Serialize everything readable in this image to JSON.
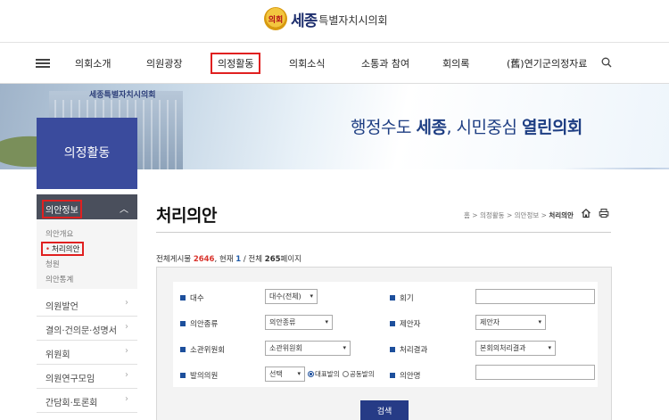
{
  "logo": {
    "emblem_text": "의회",
    "main": "세종",
    "sub": "특별자치시의회"
  },
  "gnb": {
    "menu_icon": "hamburger-icon",
    "items": [
      "의회소개",
      "의원광장",
      "의정활동",
      "의회소식",
      "소통과 참여",
      "회의록",
      "(舊)연기군의정자료"
    ],
    "active_index": 2,
    "search_icon": "search-icon"
  },
  "banner": {
    "building_label": "세종특별자치시의회",
    "slogan_pre": "행정수도 ",
    "slogan_b1": "세종",
    "slogan_mid": ", 시민중심 ",
    "slogan_b2": "열린의회"
  },
  "lnb": {
    "title": "의정활동",
    "active_section": "의안정보",
    "sub_items": [
      "의안개요",
      "처리의안",
      "청원",
      "의안통계"
    ],
    "current_sub_index": 1,
    "sections": [
      "의원발언",
      "결의·건의문·성명서",
      "위원회",
      "의원연구모임",
      "간담회·토론회"
    ]
  },
  "content": {
    "title": "처리의안",
    "breadcrumb": {
      "home": "홈",
      "l1": "의정활동",
      "l2": "의안정보",
      "current": "처리의안"
    },
    "count": {
      "prefix": "전체게시물 ",
      "total": "2646",
      "mid": ", 현재 ",
      "current": "1",
      "sep": " / 전체 ",
      "pages": "265",
      "suffix": "페이지"
    }
  },
  "form": {
    "term_label": "대수",
    "term_value": "대수(전체)",
    "session_label": "회기",
    "session_value": "",
    "bill_type_label": "의안종류",
    "bill_type_value": "의안종류",
    "proposer_label": "제안자",
    "proposer_value": "제안자",
    "committee_label": "소관위원회",
    "committee_value": "소관위원회",
    "result_label": "처리결과",
    "result_value": "본회의처리결과",
    "sponsor_label": "발의의원",
    "sponsor_value": "선택",
    "radio_main": "대표발의",
    "radio_co": "공동발의",
    "bill_name_label": "의안명",
    "bill_name_value": "",
    "search_button": "검색"
  },
  "accent": {
    "navy": "#3a4b9d",
    "red": "#d9352e",
    "highlight": "#e02020"
  }
}
